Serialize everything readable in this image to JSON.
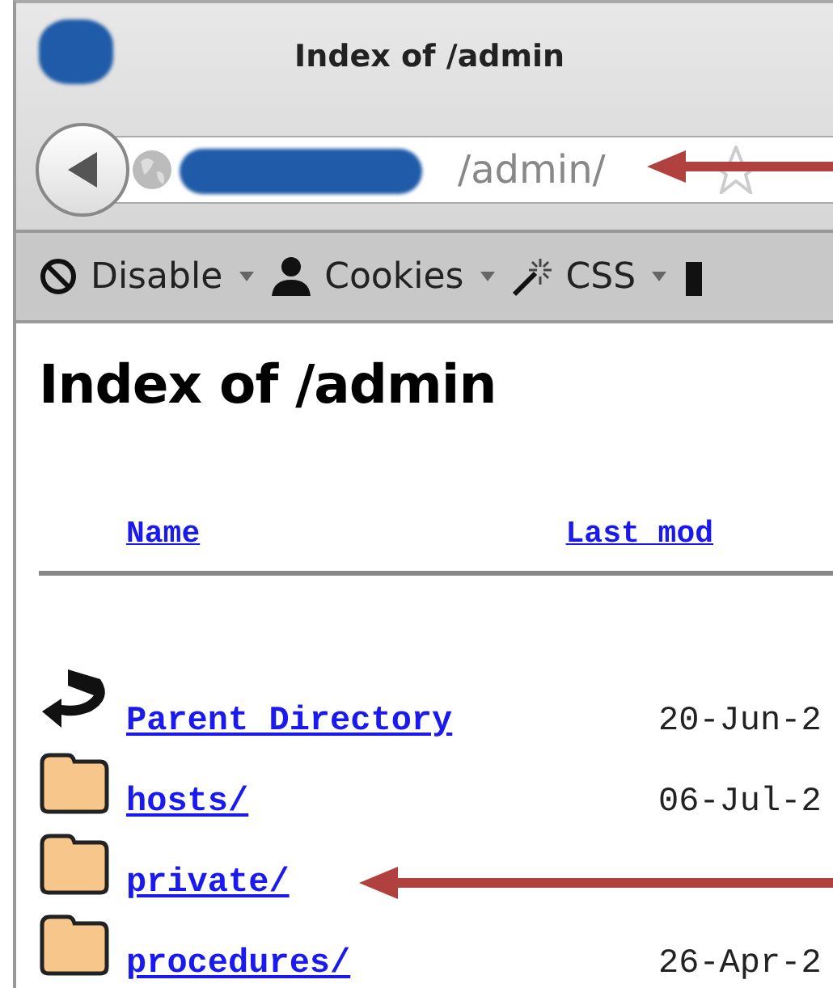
{
  "window": {
    "tab_title": "Index of /admin"
  },
  "address_bar": {
    "url_suffix": "/admin/"
  },
  "toolbar": [
    {
      "kind": "disable",
      "label": "Disable"
    },
    {
      "kind": "cookies",
      "label": "Cookies"
    },
    {
      "kind": "css",
      "label": "CSS"
    }
  ],
  "page": {
    "heading": "Index of /admin",
    "columns": [
      "Name",
      "Last mod"
    ],
    "rows": [
      {
        "kind": "parent",
        "name": "Parent Directory",
        "date": "20-Jun-2"
      },
      {
        "kind": "folder",
        "name": "hosts/",
        "date": "06-Jul-2"
      },
      {
        "kind": "folder",
        "name": "private/"
      },
      {
        "kind": "folder",
        "name": "procedures/",
        "date": "26-Apr-2"
      }
    ]
  }
}
